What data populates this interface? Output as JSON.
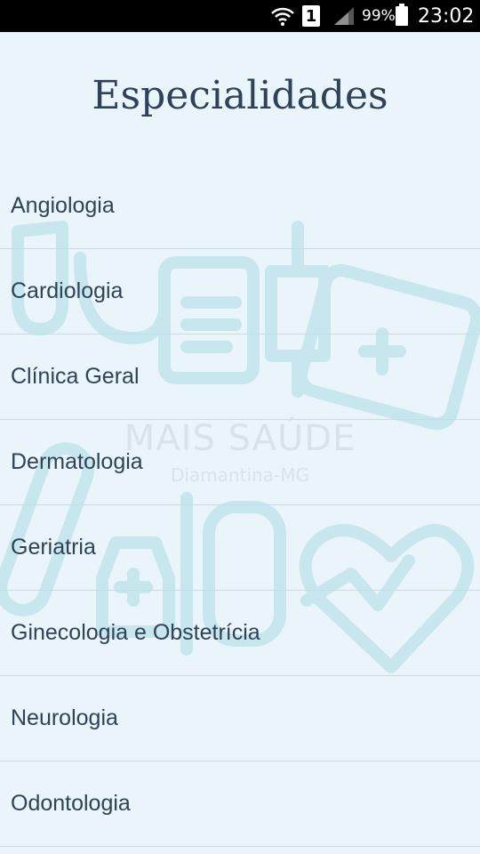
{
  "status_bar": {
    "sim_label": "1",
    "battery_percent": "99%",
    "time": "23:02"
  },
  "page_title": "Especialidades",
  "watermark": {
    "brand": "MAIS SAÚDE",
    "location": "Diamantina-MG"
  },
  "specialties": [
    {
      "label": "Angiologia"
    },
    {
      "label": "Cardiologia"
    },
    {
      "label": "Clínica Geral"
    },
    {
      "label": "Dermatologia"
    },
    {
      "label": "Geriatria"
    },
    {
      "label": "Ginecologia e Obstetrícia"
    },
    {
      "label": "Neurologia"
    },
    {
      "label": "Odontologia"
    }
  ],
  "colors": {
    "background": "#e9f5fb",
    "text": "#2f4257",
    "divider": "#cfd8de",
    "watermark": "#bfe3ec"
  }
}
